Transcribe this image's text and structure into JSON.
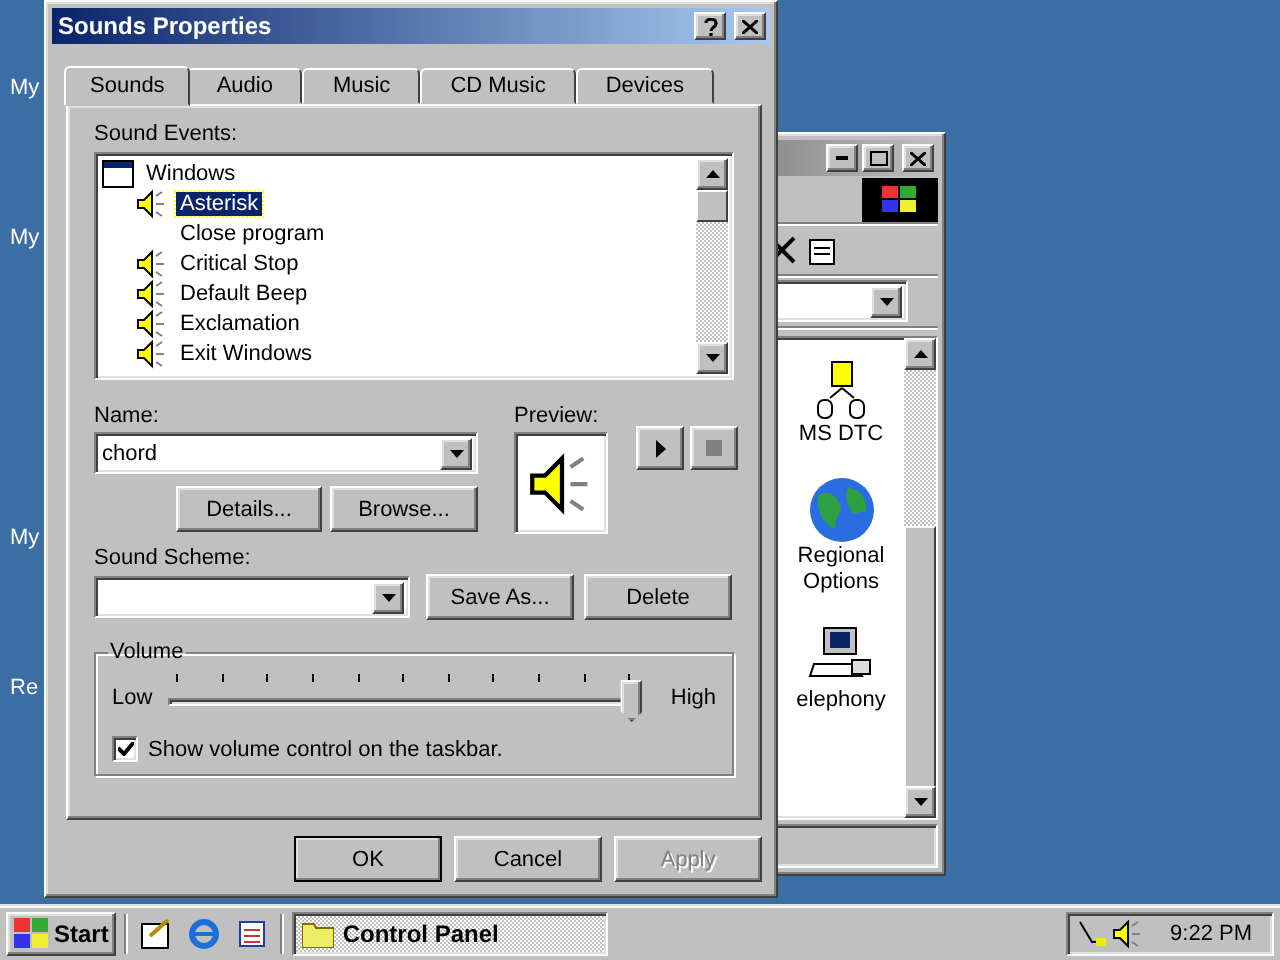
{
  "desktop_icons": [
    {
      "label": "My"
    },
    {
      "label": "My"
    },
    {
      "label": "My"
    },
    {
      "label": "Re"
    }
  ],
  "explorer_window": {
    "items": [
      {
        "label": "MS DTC",
        "kind": "dtc"
      },
      {
        "label": "Regional Options",
        "kind": "globe"
      },
      {
        "label": "elephony",
        "kind": "phone"
      }
    ]
  },
  "dialog": {
    "title": "Sounds Properties",
    "tabs": [
      {
        "label": "Sounds",
        "selected": true
      },
      {
        "label": "Audio",
        "selected": false
      },
      {
        "label": "Music",
        "selected": false
      },
      {
        "label": "CD Music",
        "selected": false
      },
      {
        "label": "Devices",
        "selected": false
      }
    ],
    "sound_events": {
      "label": "Sound Events:",
      "items": [
        {
          "label": "Windows",
          "kind": "group",
          "selected": false
        },
        {
          "label": "Asterisk",
          "kind": "sound",
          "selected": true
        },
        {
          "label": "Close program",
          "kind": "silent",
          "selected": false
        },
        {
          "label": "Critical Stop",
          "kind": "sound",
          "selected": false
        },
        {
          "label": "Default Beep",
          "kind": "sound",
          "selected": false
        },
        {
          "label": "Exclamation",
          "kind": "sound",
          "selected": false
        },
        {
          "label": "Exit Windows",
          "kind": "sound",
          "selected": false
        }
      ]
    },
    "name": {
      "label": "Name:",
      "value": "chord"
    },
    "preview": {
      "label": "Preview:"
    },
    "name_buttons": [
      "Details...",
      "Browse..."
    ],
    "sound_scheme": {
      "label": "Sound Scheme:",
      "buttons": [
        "Save As...",
        "Delete"
      ]
    },
    "volume": {
      "label": "Volume",
      "low": "Low",
      "high": "High",
      "level": 1.0,
      "show_on_taskbar": {
        "label": "Show volume control on the taskbar.",
        "checked": true
      }
    },
    "footer_buttons": [
      {
        "label": "OK",
        "disabled": false,
        "default": true
      },
      {
        "label": "Cancel",
        "disabled": false,
        "default": false
      },
      {
        "label": "Apply",
        "disabled": true,
        "default": false
      }
    ]
  },
  "taskbar": {
    "start": "Start",
    "tasks": [
      {
        "label": "Control Panel",
        "selected": true
      }
    ],
    "clock": "9:22 PM"
  }
}
